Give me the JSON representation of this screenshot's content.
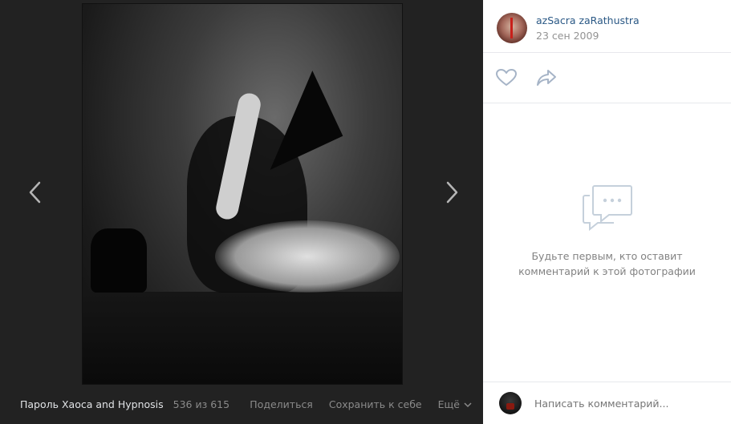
{
  "photo_viewer": {
    "album_title": "Пароль Хаоса and Hypnosis",
    "counter": "536 из 615",
    "share_label": "Поделиться",
    "save_label": "Сохранить к себе",
    "more_label": "Ещё",
    "prev_icon": "chevron-left-icon",
    "next_icon": "chevron-right-icon"
  },
  "sidebar": {
    "author_name": "azSacra zaRathustra",
    "post_date": "23 сен 2009",
    "like_icon": "heart-icon",
    "share_icon": "share-arrow-icon",
    "empty_comments_line1": "Будьте первым, кто оставит",
    "empty_comments_line2": "комментарий к этой фотографии",
    "comment_placeholder": "Написать комментарий..."
  },
  "colors": {
    "link": "#2a5885",
    "muted": "#828282",
    "icon": "#a6b4c7"
  }
}
